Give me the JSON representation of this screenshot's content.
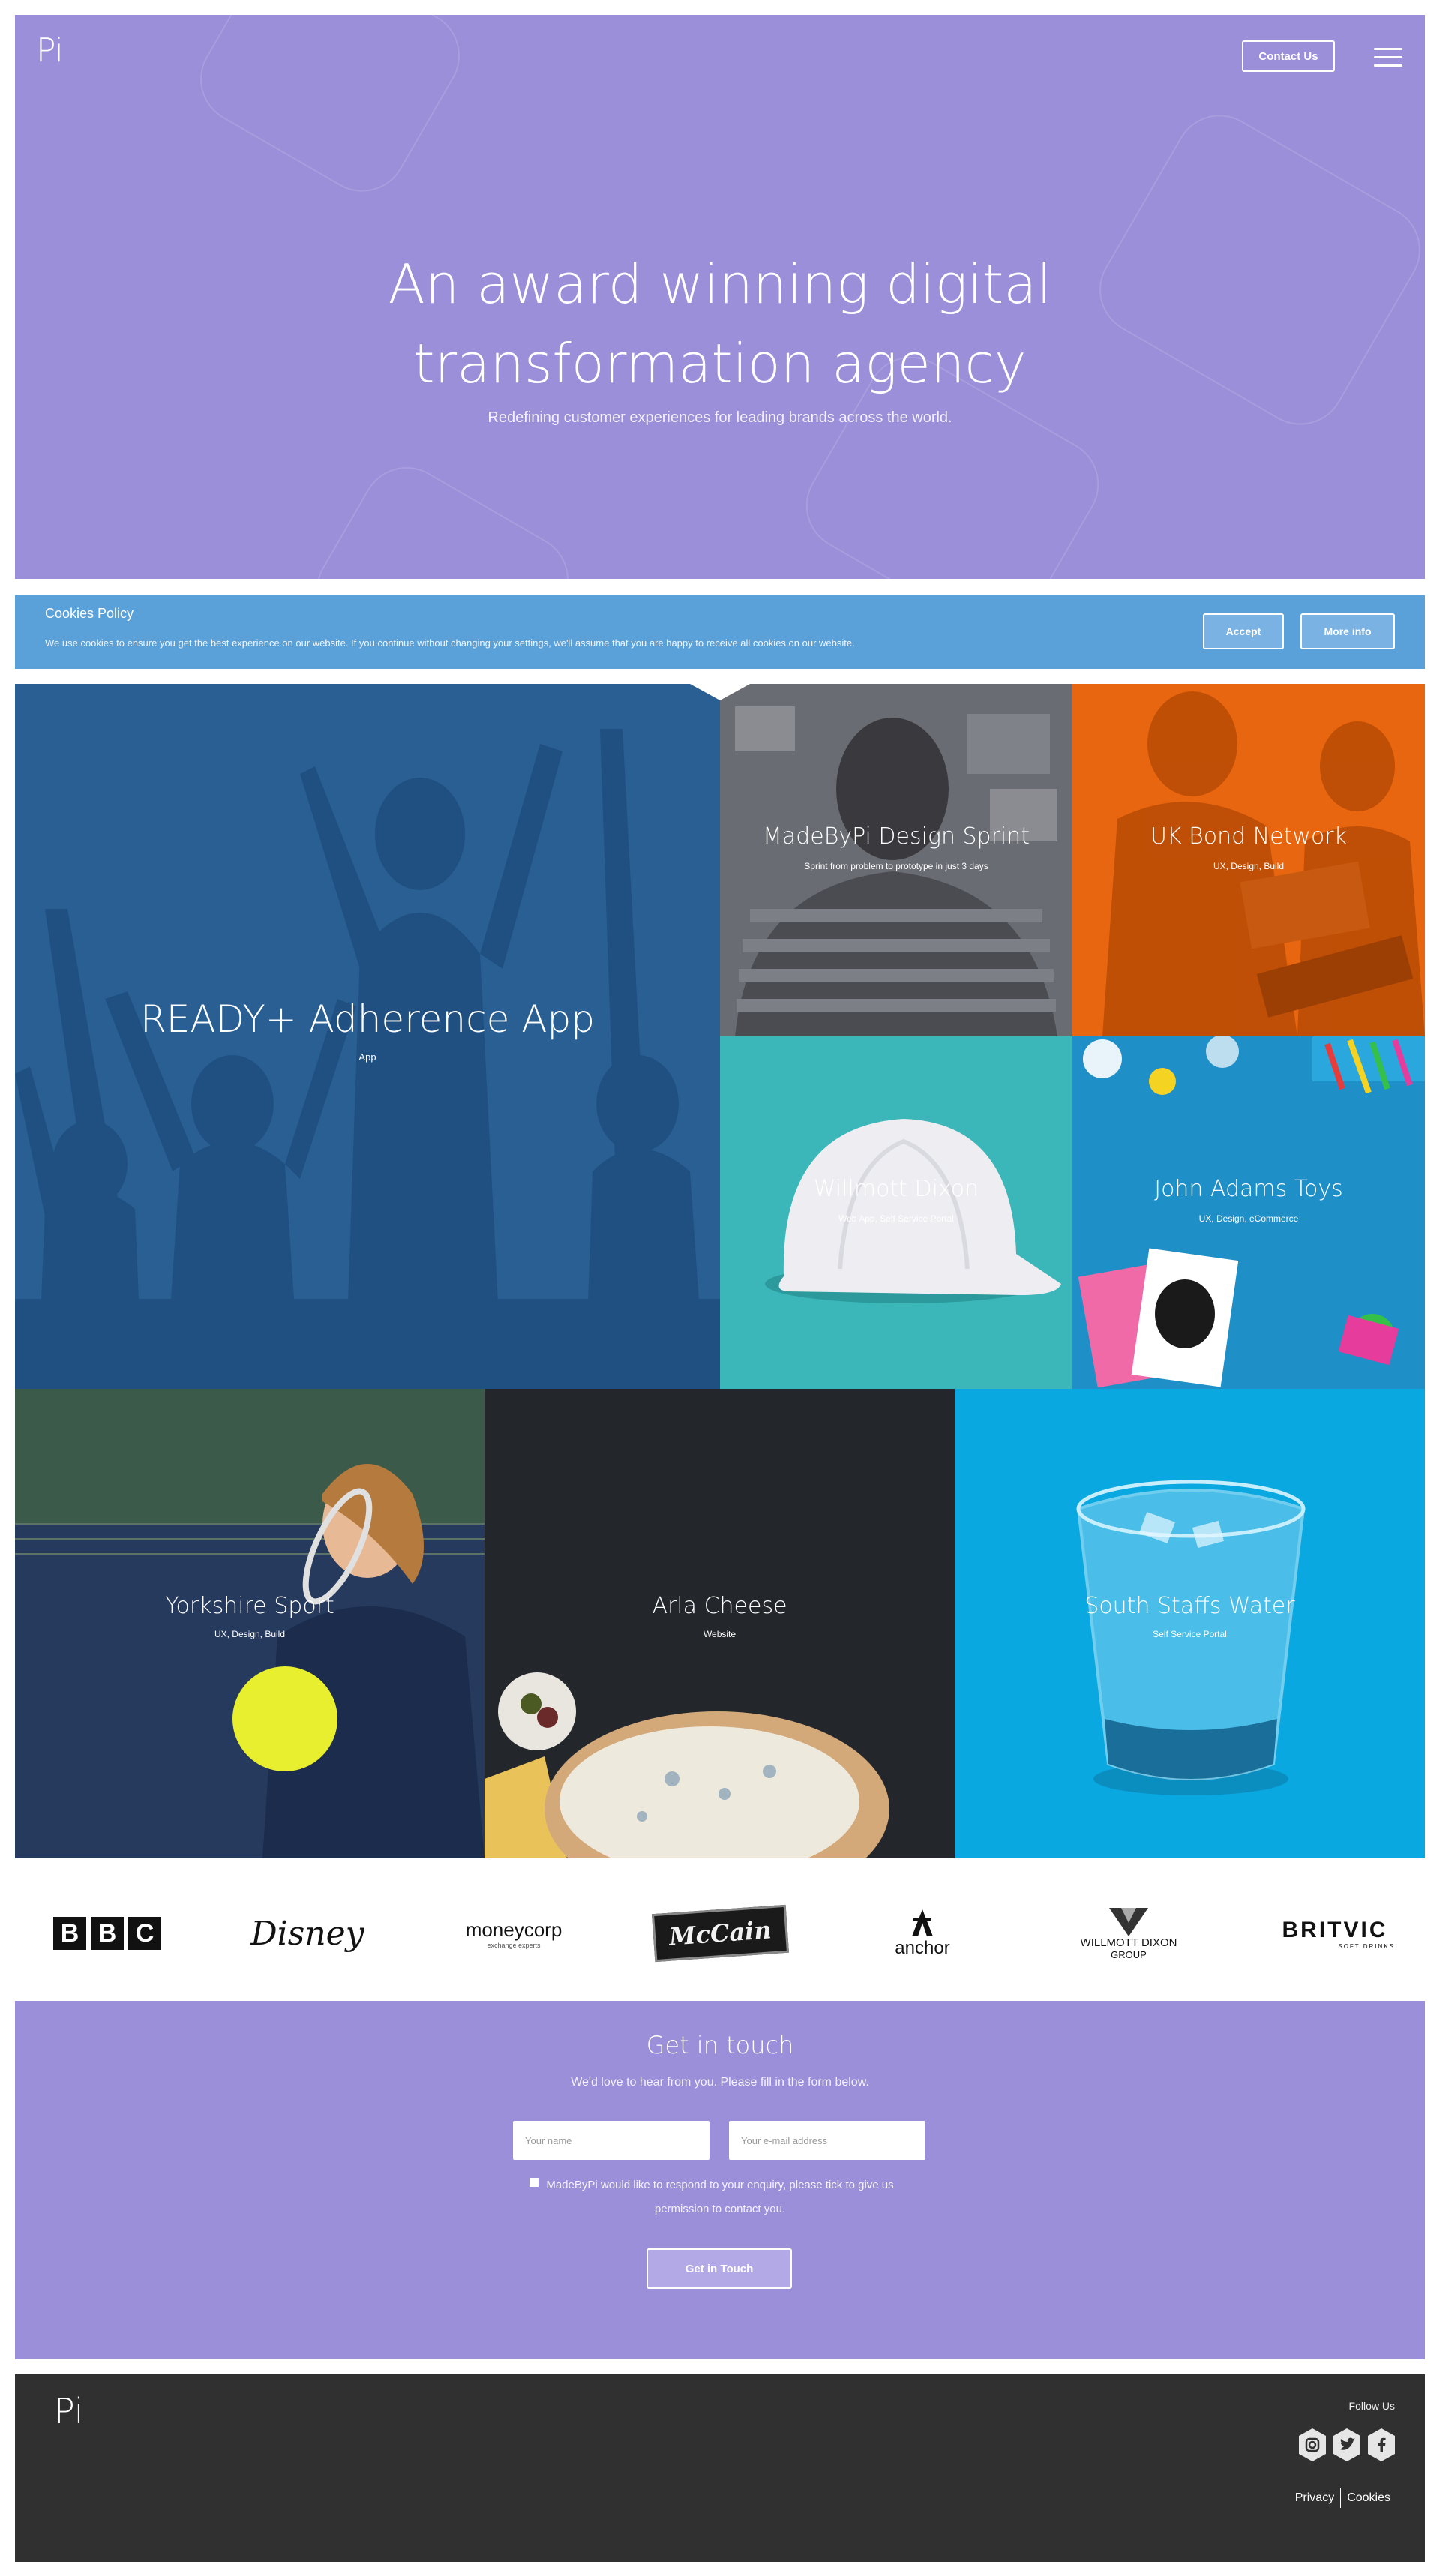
{
  "header": {
    "logo_text": "Pi",
    "contact_button": "Contact Us"
  },
  "hero": {
    "title_line1": "An award winning digital",
    "title_line2": "transformation agency",
    "subtitle": "Redefining customer experiences for leading brands across the world."
  },
  "cookies": {
    "title": "Cookies Policy",
    "text": "We use cookies to ensure you get the best experience on our website. If you continue without changing your settings, we'll assume that you are happy to receive all cookies on our website.",
    "accept_label": "Accept",
    "more_info_label": "More info"
  },
  "portfolio": {
    "items": [
      {
        "title": "READY+ Adherence App",
        "subtitle": "App"
      },
      {
        "title": "MadeByPi Design Sprint",
        "subtitle": "Sprint from problem to prototype in just 3 days"
      },
      {
        "title": "UK Bond Network",
        "subtitle": "UX, Design, Build"
      },
      {
        "title": "Willmott Dixon",
        "subtitle": "Web App, Self Service Portal"
      },
      {
        "title": "John Adams Toys",
        "subtitle": "UX, Design, eCommerce"
      },
      {
        "title": "Yorkshire Sport",
        "subtitle": "UX, Design, Build"
      },
      {
        "title": "Arla Cheese",
        "subtitle": "Website"
      },
      {
        "title": "South Staffs Water",
        "subtitle": "Self Service Portal"
      }
    ],
    "colors": {
      "ready": "#2a5f93",
      "sprint": "#5e6067",
      "bond": "#e8660f",
      "willmott": "#3bb7b9",
      "toys": "#1e8fc7",
      "sport": "#263a5e",
      "arla": "#23262b",
      "water": "#0aa8e0"
    }
  },
  "clients": {
    "bbc": "BBC",
    "disney": "Disney",
    "moneycorp": "moneycorp",
    "moneycorp_tag": "exchange experts",
    "mccain": "McCain",
    "anchor": "anchor",
    "willmott_line1": "WILLMOTT DIXON",
    "willmott_line2": "GROUP",
    "britvic": "BRITVIC",
    "britvic_tag": "SOFT DRINKS"
  },
  "contact": {
    "title": "Get in touch",
    "text": "We'd love to hear from you. Please fill in the form below.",
    "name_placeholder": "Your name",
    "email_placeholder": "Your e-mail address",
    "consent_text": "MadeByPi would like to respond to your enquiry, please tick to give us permission to contact you.",
    "submit_label": "Get in Touch"
  },
  "footer": {
    "logo_text": "Pi",
    "follow_label": "Follow Us",
    "social": [
      "instagram-icon",
      "twitter-icon",
      "facebook-icon"
    ],
    "privacy_label": "Privacy",
    "cookies_label": "Cookies"
  },
  "colors": {
    "brand_purple": "#9b8fd9",
    "cookie_blue": "#5aa0d9",
    "footer_dark": "#303030"
  }
}
